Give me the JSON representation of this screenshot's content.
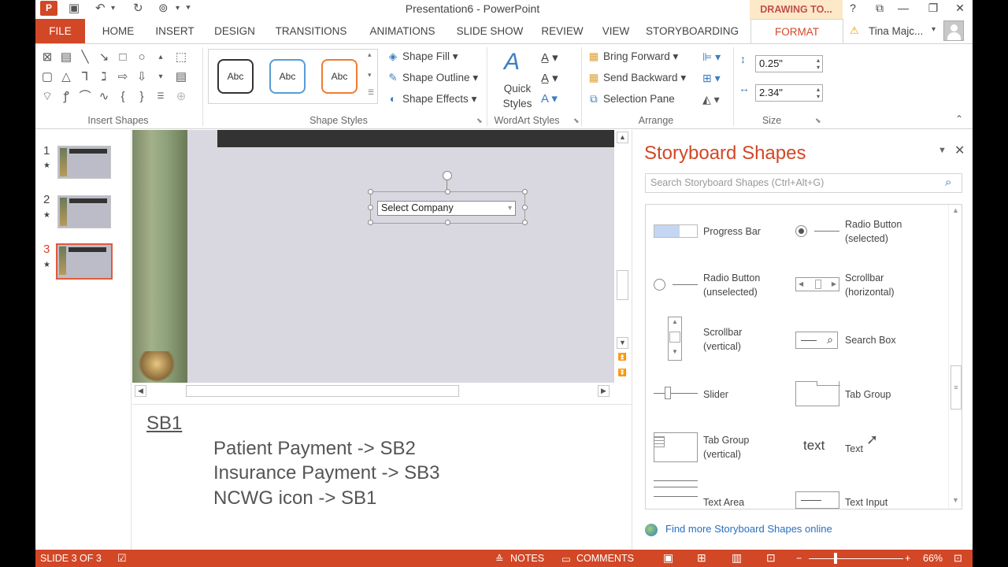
{
  "window": {
    "title": "Presentation6 - PowerPoint",
    "context_tab_group": "DRAWING TO...",
    "help": "?"
  },
  "tabs": [
    "FILE",
    "HOME",
    "INSERT",
    "DESIGN",
    "TRANSITIONS",
    "ANIMATIONS",
    "SLIDE SHOW",
    "REVIEW",
    "VIEW",
    "STORYBOARDING",
    "FORMAT"
  ],
  "user": {
    "name": "Tina Majc..."
  },
  "ribbon": {
    "groups": [
      "Insert Shapes",
      "Shape Styles",
      "WordArt Styles",
      "Arrange",
      "Size"
    ],
    "style_samples": [
      "Abc",
      "Abc",
      "Abc"
    ],
    "shape_fill": "Shape Fill",
    "shape_outline": "Shape Outline",
    "shape_effects": "Shape Effects",
    "quick_styles": "Quick Styles",
    "bring_forward": "Bring Forward",
    "send_backward": "Send Backward",
    "selection_pane": "Selection Pane",
    "height": "0.25\"",
    "width": "2.34\""
  },
  "thumbnails": [
    {
      "number": "1",
      "star": "★"
    },
    {
      "number": "2",
      "star": "★"
    },
    {
      "number": "3",
      "star": "★",
      "selected": true
    }
  ],
  "slide": {
    "combo_value": "Select Company"
  },
  "notes": {
    "title": "SB1",
    "lines": [
      "Patient Payment -> SB2",
      "Insurance Payment -> SB3",
      "NCWG icon -> SB1"
    ]
  },
  "storyboard": {
    "title": "Storyboard Shapes",
    "search_placeholder": "Search Storyboard Shapes (Ctrl+Alt+G)",
    "items": [
      {
        "line1": "Progress Bar",
        "line2": ""
      },
      {
        "line1": "Radio Button",
        "line2": "(selected)"
      },
      {
        "line1": "Radio Button",
        "line2": "(unselected)"
      },
      {
        "line1": "Scrollbar",
        "line2": "(horizontal)"
      },
      {
        "line1": "Scrollbar",
        "line2": "(vertical)"
      },
      {
        "line1": "Search Box",
        "line2": ""
      },
      {
        "line1": "Slider",
        "line2": ""
      },
      {
        "line1": "Tab Group",
        "line2": ""
      },
      {
        "line1": "Tab Group",
        "line2": "(vertical)"
      },
      {
        "line1": "Text",
        "line2": ""
      },
      {
        "line1": "Text Area",
        "line2": ""
      },
      {
        "line1": "Text Input",
        "line2": ""
      }
    ],
    "text_preview": "text",
    "find_more": "Find more Storyboard Shapes online"
  },
  "status": {
    "slide_info": "SLIDE 3 OF 3",
    "notes": "NOTES",
    "comments": "COMMENTS",
    "zoom": "66%"
  },
  "colors": {
    "accent": "#d24726",
    "link": "#2a6fbf"
  }
}
